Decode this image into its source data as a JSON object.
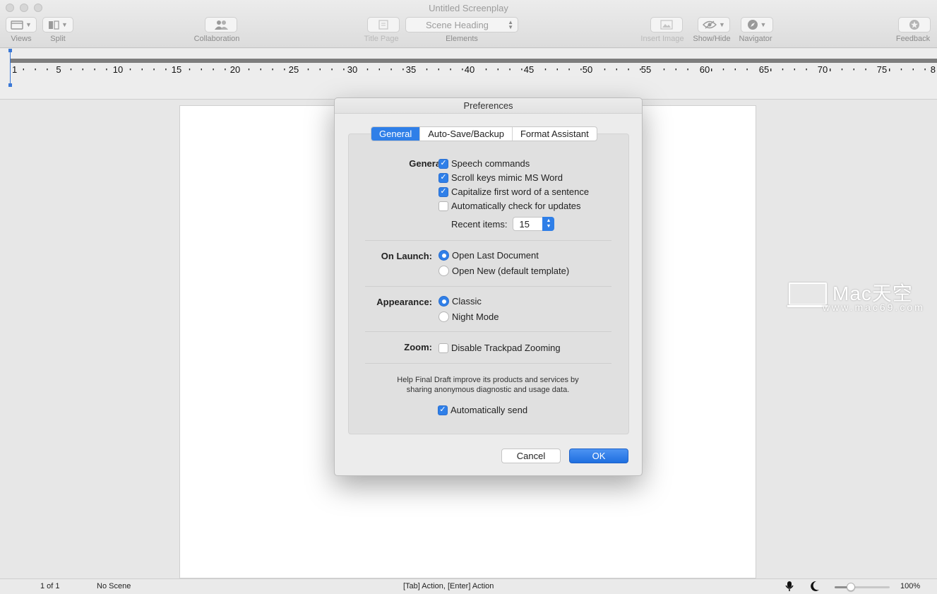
{
  "window": {
    "title": "Untitled Screenplay"
  },
  "toolbar": {
    "views_label": "Views",
    "split_label": "Split",
    "collaboration_label": "Collaboration",
    "title_page_label": "Title Page",
    "elements_label": "Elements",
    "elements_value": "Scene Heading",
    "insert_image_label": "Insert Image",
    "show_hide_label": "Show/Hide",
    "navigator_label": "Navigator",
    "feedback_label": "Feedback"
  },
  "ruler": {
    "labels": [
      "1",
      "5",
      "10",
      "15",
      "20",
      "25",
      "30",
      "35",
      "40",
      "45",
      "50",
      "55",
      "60",
      "65",
      "70",
      "75",
      "8"
    ]
  },
  "watermark": {
    "text": "Mac天空",
    "url": "www.mac69.com"
  },
  "dialog": {
    "title": "Preferences",
    "tabs": [
      "General",
      "Auto-Save/Backup",
      "Format Assistant"
    ],
    "active_tab": "General",
    "general": {
      "label": "General:",
      "speech_commands": "Speech commands",
      "scroll_keys": "Scroll keys mimic MS Word",
      "capitalize": "Capitalize first word of a sentence",
      "auto_check": "Automatically check for updates",
      "recent_items_label": "Recent items:",
      "recent_items_value": "15"
    },
    "on_launch": {
      "label": "On Launch:",
      "open_last": "Open Last Document",
      "open_new": "Open New (default template)"
    },
    "appearance": {
      "label": "Appearance:",
      "classic": "Classic",
      "night_mode": "Night Mode"
    },
    "zoom": {
      "label": "Zoom:",
      "disable_trackpad": "Disable Trackpad Zooming"
    },
    "help_text_1": "Help Final Draft improve its products and services by",
    "help_text_2": "sharing anonymous diagnostic and usage data.",
    "auto_send": "Automatically send",
    "cancel": "Cancel",
    "ok": "OK"
  },
  "status": {
    "page": "1 of 1",
    "scene": "No Scene",
    "hint": "[Tab]  Action,  [Enter] Action",
    "zoom": "100%",
    "zoom_level": 0.3
  },
  "colors": {
    "accent": "#2f7fe8",
    "ruler_marker": "#3a78d6"
  }
}
